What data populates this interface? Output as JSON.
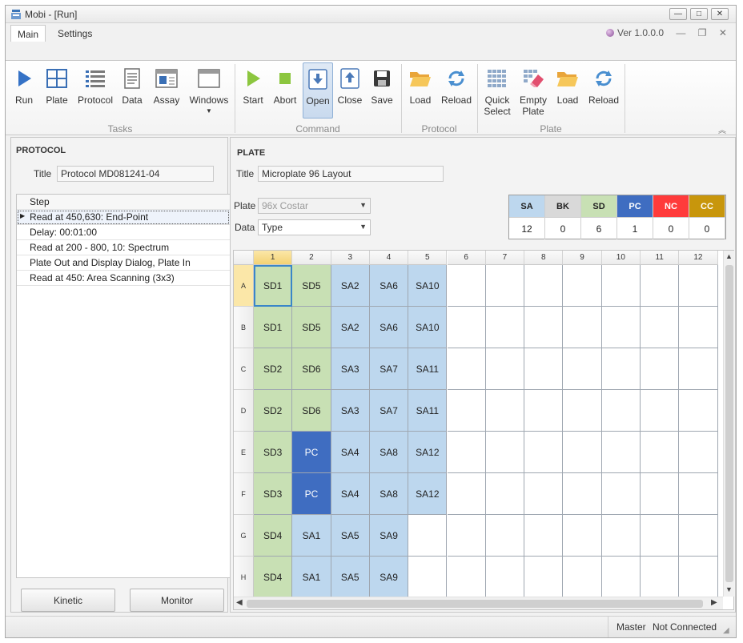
{
  "window": {
    "title": "Mobi - [Run]",
    "controls": [
      "minimize",
      "maximize",
      "close"
    ]
  },
  "ribbon": {
    "tabs": [
      {
        "label": "Main",
        "selected": true
      },
      {
        "label": "Settings",
        "selected": false
      }
    ],
    "version": "Ver  1.0.0.0",
    "groups": [
      {
        "label": "Tasks",
        "buttons": [
          {
            "label": "Run",
            "icon": "play-icon"
          },
          {
            "label": "Plate",
            "icon": "plate-layout-icon"
          },
          {
            "label": "Protocol",
            "icon": "list-icon"
          },
          {
            "label": "Data",
            "icon": "document-icon"
          },
          {
            "label": "Assay",
            "icon": "assay-icon"
          },
          {
            "label": "Windows",
            "icon": "windows-icon"
          }
        ]
      },
      {
        "label": "Command",
        "buttons": [
          {
            "label": "Start",
            "icon": "start-icon"
          },
          {
            "label": "Abort",
            "icon": "stop-icon"
          },
          {
            "label": "Open",
            "icon": "open-icon"
          },
          {
            "label": "Close",
            "icon": "close-tray-icon"
          },
          {
            "label": "Save",
            "icon": "save-icon"
          }
        ]
      },
      {
        "label": "Protocol",
        "buttons": [
          {
            "label": "Load",
            "icon": "folder-open-icon"
          },
          {
            "label": "Reload",
            "icon": "reload-icon"
          }
        ]
      },
      {
        "label": "Plate",
        "buttons": [
          {
            "label": "Quick Select",
            "line1": "Quick",
            "line2": "Select",
            "icon": "quick-select-icon"
          },
          {
            "label": "Empty Plate",
            "line1": "Empty",
            "line2": "Plate",
            "icon": "eraser-icon"
          },
          {
            "label": "Load",
            "icon": "folder-open-icon"
          },
          {
            "label": "Reload",
            "icon": "reload-icon"
          }
        ]
      }
    ]
  },
  "protocol": {
    "heading": "PROTOCOL",
    "title_label": "Title",
    "title_value": "Protocol MD081241-04",
    "step_header": "Step",
    "steps": [
      "Read at 450,630: End-Point",
      "Delay: 00:01:00",
      "Read at 200 - 800, 10: Spectrum",
      "Plate Out and Display Dialog, Plate In",
      "Read at 450: Area Scanning (3x3)"
    ],
    "selected_step": 0,
    "buttons": {
      "kinetic": "Kinetic",
      "monitor": "Monitor"
    }
  },
  "plate": {
    "heading": "PLATE",
    "title_label": "Title",
    "title_value": "Microplate 96 Layout",
    "plate_label": "Plate",
    "plate_value": "96x Costar",
    "data_label": "Data",
    "data_value": "Type",
    "legend": [
      {
        "code": "SA",
        "count": "12",
        "color": "#bdd7ee",
        "text_color": "#222222"
      },
      {
        "code": "BK",
        "count": "0",
        "color": "#d9d9d9",
        "text_color": "#222222"
      },
      {
        "code": "SD",
        "count": "6",
        "color": "#c8e0b4",
        "text_color": "#222222"
      },
      {
        "code": "PC",
        "count": "1",
        "color": "#3f6dc1",
        "text_color": "#ffffff"
      },
      {
        "code": "NC",
        "count": "0",
        "color": "#ff3b3b",
        "text_color": "#ffffff"
      },
      {
        "code": "CC",
        "count": "0",
        "color": "#c8960c",
        "text_color": "#ffffff"
      }
    ],
    "columns": [
      "1",
      "2",
      "3",
      "4",
      "5",
      "6",
      "7",
      "8",
      "9",
      "10",
      "11",
      "12"
    ],
    "rows": [
      "A",
      "B",
      "C",
      "D",
      "E",
      "F",
      "G",
      "H"
    ],
    "wells": [
      [
        "SD1",
        "SD5",
        "SA2",
        "SA6",
        "SA10",
        "",
        "",
        "",
        "",
        "",
        "",
        ""
      ],
      [
        "SD1",
        "SD5",
        "SA2",
        "SA6",
        "SA10",
        "",
        "",
        "",
        "",
        "",
        "",
        ""
      ],
      [
        "SD2",
        "SD6",
        "SA3",
        "SA7",
        "SA11",
        "",
        "",
        "",
        "",
        "",
        "",
        ""
      ],
      [
        "SD2",
        "SD6",
        "SA3",
        "SA7",
        "SA11",
        "",
        "",
        "",
        "",
        "",
        "",
        ""
      ],
      [
        "SD3",
        "PC",
        "SA4",
        "SA8",
        "SA12",
        "",
        "",
        "",
        "",
        "",
        "",
        ""
      ],
      [
        "SD3",
        "PC",
        "SA4",
        "SA8",
        "SA12",
        "",
        "",
        "",
        "",
        "",
        "",
        ""
      ],
      [
        "SD4",
        "SA1",
        "SA5",
        "SA9",
        "",
        "",
        "",
        "",
        "",
        "",
        "",
        ""
      ],
      [
        "SD4",
        "SA1",
        "SA5",
        "SA9",
        "",
        "",
        "",
        "",
        "",
        "",
        "",
        ""
      ]
    ],
    "selected_well": "A1"
  },
  "status": {
    "mode": "Master",
    "connection": "Not Connected"
  }
}
